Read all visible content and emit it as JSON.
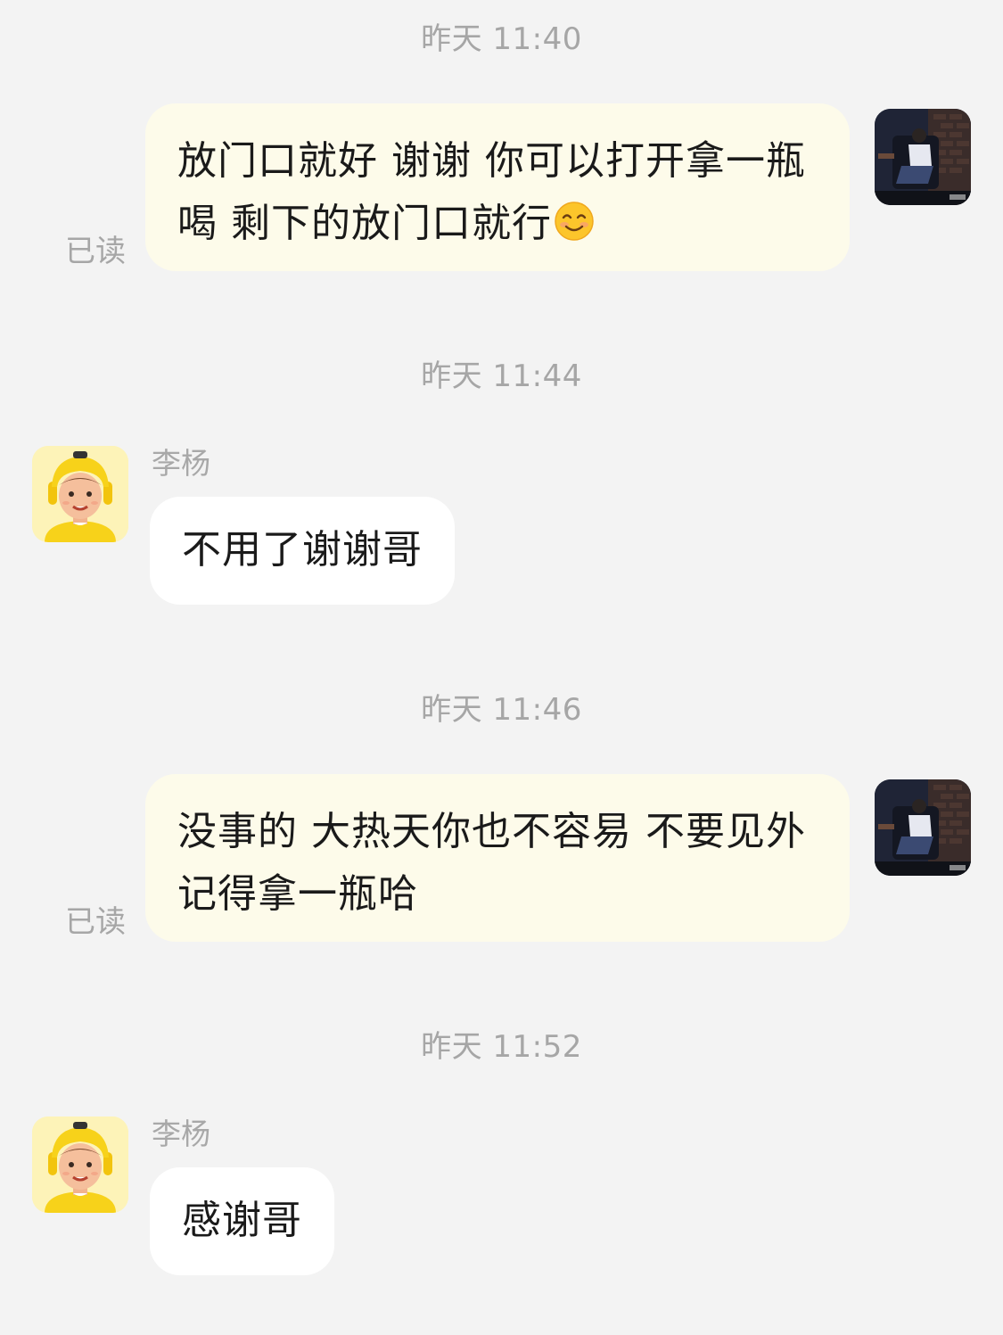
{
  "messages": [
    {
      "timestamp": "昨天 11:40",
      "text": "放门口就好 谢谢 你可以打开拿一瓶喝 剩下的放门口就行",
      "emoji": "smiling-face-icon",
      "read_status": "已读"
    },
    {
      "timestamp": "昨天 11:44",
      "sender": "李杨",
      "text": "不用了谢谢哥"
    },
    {
      "timestamp": "昨天 11:46",
      "text": "没事的 大热天你也不容易 不要见外 记得拿一瓶哈",
      "read_status": "已读"
    },
    {
      "timestamp": "昨天 11:52",
      "sender": "李杨",
      "text": "感谢哥"
    }
  ],
  "colors": {
    "background": "#f3f3f3",
    "sent_bubble": "#fdfbea",
    "received_bubble": "#ffffff",
    "muted_text": "#a6a6a6",
    "courier_avatar_bg": "#fdf3b8",
    "courier_helmet": "#f7d21a"
  }
}
